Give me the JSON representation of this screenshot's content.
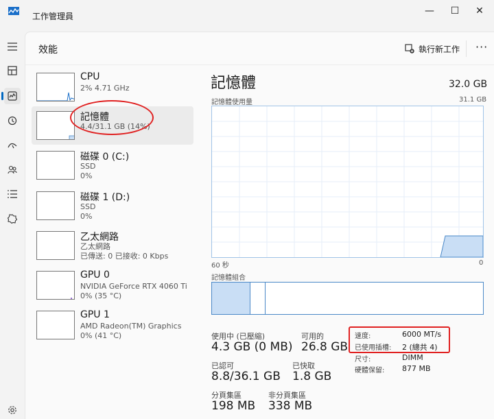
{
  "window": {
    "title": "工作管理員",
    "minimize": "—",
    "maximize": "☐",
    "close": "✕"
  },
  "nav": [
    {
      "name": "hamburger-icon",
      "label": "☰"
    },
    {
      "name": "processes-icon",
      "label": ""
    },
    {
      "name": "performance-icon",
      "label": ""
    },
    {
      "name": "app-history-icon",
      "label": ""
    },
    {
      "name": "startup-apps-icon",
      "label": ""
    },
    {
      "name": "users-icon",
      "label": ""
    },
    {
      "name": "details-icon",
      "label": ""
    },
    {
      "name": "services-icon",
      "label": ""
    },
    {
      "name": "settings-icon",
      "label": ""
    }
  ],
  "header": {
    "title": "效能",
    "run_task": "執行新工作",
    "more": "···"
  },
  "sidebar": [
    {
      "title": "CPU",
      "sub1": "2% 4.71 GHz",
      "sub2": ""
    },
    {
      "title": "記憶體",
      "sub1": "4.4/31.1 GB (14%)",
      "sub2": ""
    },
    {
      "title": "磁碟 0 (C:)",
      "sub1": "SSD",
      "sub2": "0%"
    },
    {
      "title": "磁碟 1 (D:)",
      "sub1": "SSD",
      "sub2": "0%"
    },
    {
      "title": "乙太網路",
      "sub1": "乙太網路",
      "sub2": "已傳送: 0 已接收: 0 Kbps"
    },
    {
      "title": "GPU 0",
      "sub1": "NVIDIA GeForce RTX 4060 Ti",
      "sub2": "0% (35 °C)"
    },
    {
      "title": "GPU 1",
      "sub1": "AMD Radeon(TM) Graphics",
      "sub2": "0% (41 °C)"
    }
  ],
  "memory": {
    "title": "記憶體",
    "total": "32.0 GB",
    "usage_label": "記憶體使用量",
    "usage_max": "31.1 GB",
    "graph_left": "60 秒",
    "graph_right": "0",
    "composition_label": "記憶體組合",
    "stats": {
      "in_use_label": "使用中 (已壓縮)",
      "in_use": "4.3 GB (0 MB)",
      "available_label": "可用的",
      "available": "26.8 GB",
      "committed_label": "已認可",
      "committed": "8.8/36.1 GB",
      "cached_label": "已快取",
      "cached": "1.8 GB",
      "paged_label": "分頁集區",
      "paged": "198 MB",
      "nonpaged_label": "非分頁集區",
      "nonpaged": "338 MB"
    },
    "details": {
      "speed_label": "速度:",
      "speed": "6000 MT/s",
      "slots_label": "已使用插槽:",
      "slots": "2 (總共 4)",
      "form_label": "尺寸:",
      "form": "DIMM",
      "reserved_label": "硬體保留:",
      "reserved": "877 MB"
    }
  },
  "colors": {
    "accent": "#0067c0",
    "mem_fill": "#c9def5",
    "mem_line": "#4a88c7",
    "annotation": "#e02020"
  }
}
